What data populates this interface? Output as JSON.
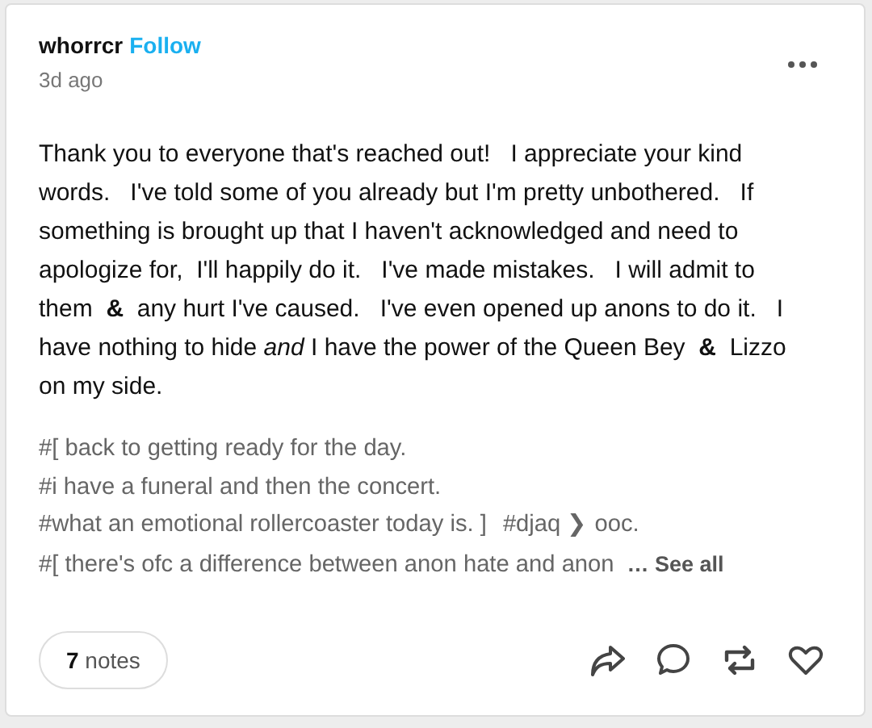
{
  "post": {
    "author": "whorrcr",
    "follow": "Follow",
    "time": "3d ago",
    "body": "Thank you to everyone that's reached out!   I appreciate your kind words.   I've told some of you already but I'm pretty unbothered.   If something is brought up that I haven't acknowledged and need to apologize for,  I'll happily do it.   I've made mistakes.   I will admit to them  **&**  any hurt I've caused.   I've even opened up anons to do it.   I have nothing to hide *and* I have the power of the Queen Bey  **&**  Lizzo on my side.",
    "tags": [
      "#[ back to getting ready for the day.",
      "#i have a funeral and then the concert.",
      "#what an emotional rollercoaster today is. ]",
      "#djaq ❯ ooc.",
      "#[ there's ofc a difference between anon hate and anon"
    ],
    "see_all": "… See all",
    "notes": "**7** notes"
  }
}
